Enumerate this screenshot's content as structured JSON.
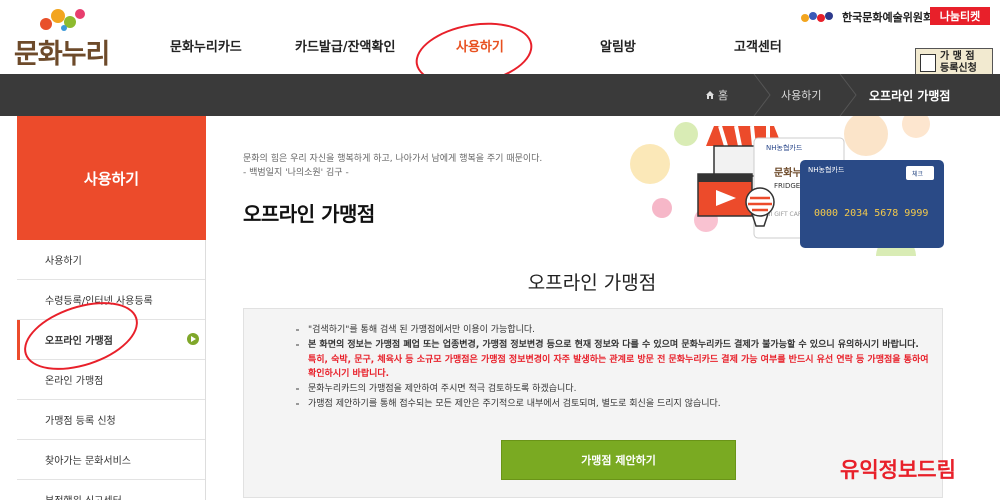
{
  "header": {
    "logo_text": "문화누리",
    "org_name": "한국문화예술위원회",
    "nanum_ticket": "나눔티켓",
    "partner_register": [
      "가 맹 점",
      "등록신청"
    ]
  },
  "nav": [
    {
      "label": "문화누리카드",
      "active": false
    },
    {
      "label": "카드발급/잔액확인",
      "active": false
    },
    {
      "label": "사용하기",
      "active": true
    },
    {
      "label": "알림방",
      "active": false
    },
    {
      "label": "고객센터",
      "active": false
    }
  ],
  "breadcrumb": {
    "home": "홈",
    "level1": "사용하기",
    "current": "오프라인 가맹점"
  },
  "sidebar": {
    "title": "사용하기",
    "items": [
      {
        "label": "사용하기",
        "active": false
      },
      {
        "label": "수령등록/인터넷 사용등록",
        "active": false
      },
      {
        "label": "오프라인 가맹점",
        "active": true
      },
      {
        "label": "온라인 가맹점",
        "active": false
      },
      {
        "label": "가맹점 등록 신청",
        "active": false
      },
      {
        "label": "찾아가는 문화서비스",
        "active": false
      },
      {
        "label": "부정행위 신고센터",
        "active": false
      }
    ]
  },
  "main": {
    "quote_line1": "문화의 힘은 우리 자신을 행복하게 하고, 나아가서 남에게 행복을 주기 때문이다.",
    "quote_line2": "- 백범일지 '나의소원' 김구 -",
    "page_title": "오프라인 가맹점",
    "content_title": "오프라인 가맹점",
    "notices": [
      {
        "text": "\"검색하기\"를 통해 검색 된 가맹점에서만 이용이 가능합니다.",
        "style": "normal"
      },
      {
        "text": "본 화면의 정보는 가맹점 폐업 또는 업종변경, 가맹점 정보변경 등으로 현재 정보와 다를 수 있으며 문화누리카드 결제가 불가능할 수 있으니 유의하시기 바랍니다.",
        "style": "bold"
      },
      {
        "text": "특히, 숙박, 문구, 체육사 등 소규모 가맹점은 가맹점 정보변경이 자주 발생하는 관계로 방문 전 문화누리카드 결제 가능 여부를 반드시 유선 연락 등 가맹점을 통하여 확인하시기 바랍니다.",
        "style": "red"
      },
      {
        "text": "문화누리카드의 가맹점을 제안하여 주시면 적극 검토하도록 하겠습니다.",
        "style": "normal"
      },
      {
        "text": "가맹점 제안하기를 통해 접수되는 모든 제안은 주기적으로 내부에서 검토되며, 별도로 회신을 드리지 않습니다.",
        "style": "normal"
      }
    ],
    "suggest_button": "가맹점 제안하기",
    "watermark": "유익정보드림"
  },
  "illustration": {
    "card_bank": "NH농협카드",
    "card_number": "0000 2034 5678 9999",
    "card_badge": "체크",
    "card_brand": "문화누리",
    "card_brand2": "FRIDGE",
    "gift_card": "HI GIFT CARD"
  },
  "colors": {
    "accent": "#ec4b2b",
    "nav_active": "#e8501f",
    "button": "#7aaa22",
    "breadcrumb_bg": "#3a3a3a",
    "annotation_red": "#e8202a"
  }
}
